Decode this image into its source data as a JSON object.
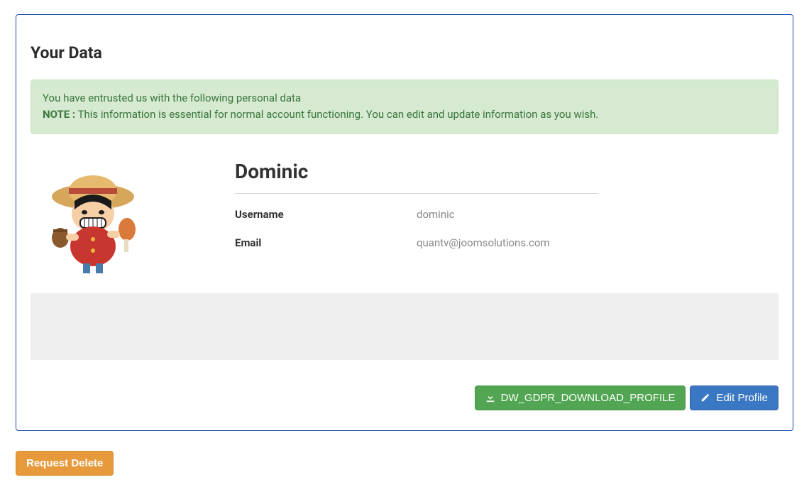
{
  "page": {
    "title": "Your Data"
  },
  "alert": {
    "line1": "You have entrusted us with the following personal data",
    "note_label": "NOTE :",
    "note_text": " This information is essential for normal account functioning. You can edit and update information as you wish."
  },
  "profile": {
    "display_name": "Dominic",
    "fields": {
      "username_label": "Username",
      "username_value": "dominic",
      "email_label": "Email",
      "email_value": "quantv@joomsolutions.com"
    }
  },
  "buttons": {
    "download_profile": "DW_GDPR_DOWNLOAD_PROFILE",
    "edit_profile": "Edit Profile",
    "request_delete": "Request Delete"
  }
}
